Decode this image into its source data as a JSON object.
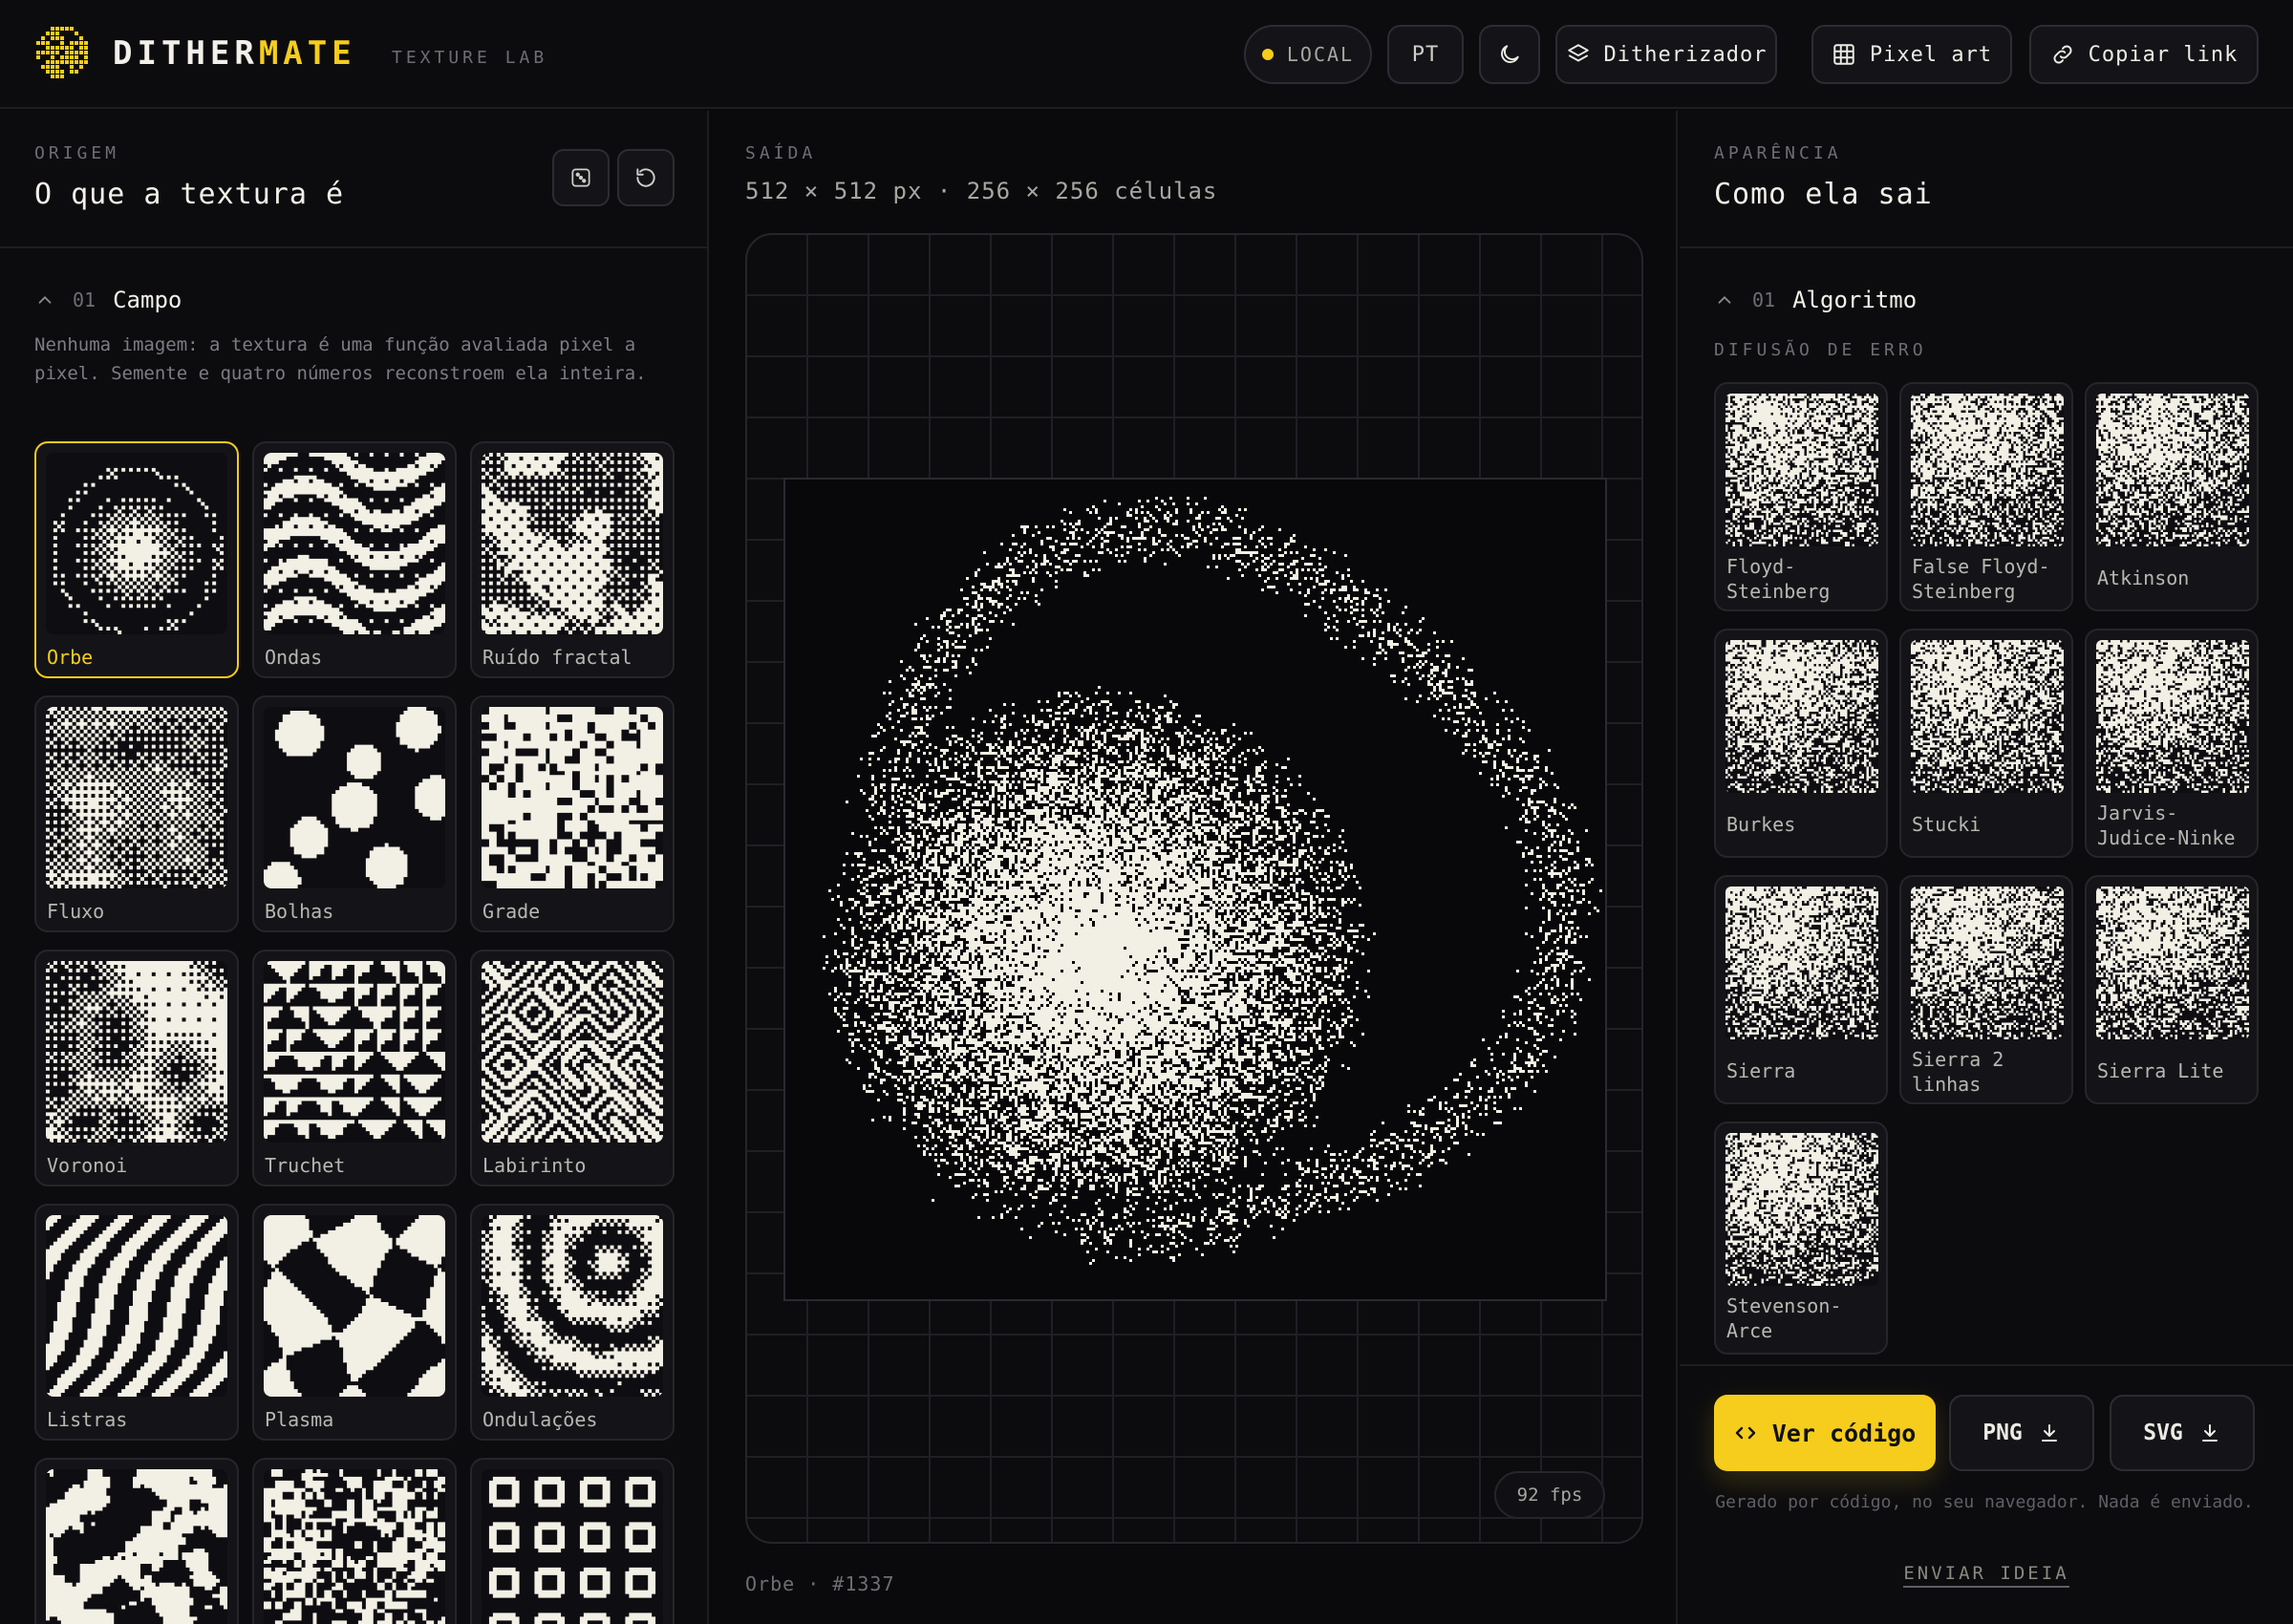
{
  "header": {
    "brand_main": "DITHER",
    "brand_accent": "MATE",
    "brand_sub": "TEXTURE LAB",
    "local_label": "LOCAL",
    "lang_label": "PT",
    "dither_label": "Ditherizador",
    "pixel_label": "Pixel art",
    "copy_label": "Copiar link"
  },
  "left": {
    "section_label": "ORIGEM",
    "title": "O que a textura é",
    "group_num": "01",
    "group_name": "Campo",
    "description": "Nenhuma imagem: a textura é uma função avaliada pixel a pixel. Semente e quatro números reconstroem ela inteira.",
    "fields": [
      {
        "name": "Orbe",
        "selected": true,
        "pattern": "orb"
      },
      {
        "name": "Ondas",
        "pattern": "waves"
      },
      {
        "name": "Ruído fractal",
        "pattern": "noise"
      },
      {
        "name": "Fluxo",
        "pattern": "flow"
      },
      {
        "name": "Bolhas",
        "pattern": "bubbles"
      },
      {
        "name": "Grade",
        "pattern": "grid"
      },
      {
        "name": "Voronoi",
        "pattern": "voronoi"
      },
      {
        "name": "Truchet",
        "pattern": "truchet"
      },
      {
        "name": "Labirinto",
        "pattern": "maze"
      },
      {
        "name": "Listras",
        "pattern": "stripes"
      },
      {
        "name": "Plasma",
        "pattern": "plasma"
      },
      {
        "name": "Ondulações",
        "pattern": "ripples"
      },
      {
        "name": "",
        "pattern": "rd"
      },
      {
        "name": "",
        "pattern": "cells"
      },
      {
        "name": "",
        "pattern": "rings"
      }
    ]
  },
  "middle": {
    "section_label": "SAÍDA",
    "dimensions": "512 × 512 px · 256 × 256 células",
    "fps": "92 fps",
    "footer": "Orbe · #1337"
  },
  "right": {
    "section_label": "APARÊNCIA",
    "title": "Como ela sai",
    "group_num": "01",
    "group_name": "Algoritmo",
    "sub_label": "DIFUSÃO DE ERRO",
    "algorithms": [
      {
        "name": "Floyd-\nSteinberg"
      },
      {
        "name": "False Floyd-\nSteinberg"
      },
      {
        "name": "Atkinson"
      },
      {
        "name": "Burkes"
      },
      {
        "name": "Stucki"
      },
      {
        "name": "Jarvis-\nJudice-Ninke"
      },
      {
        "name": "Sierra"
      },
      {
        "name": "Sierra 2\nlinhas"
      },
      {
        "name": "Sierra Lite"
      },
      {
        "name": "Stevenson-\nArce"
      }
    ],
    "code_label": "Ver código",
    "png_label": "PNG",
    "svg_label": "SVG",
    "note": "Gerado por código, no seu navegador. Nada é enviado.",
    "idea_label": "ENVIAR IDEIA"
  },
  "colors": {
    "accent": "#f6cd1c",
    "background": "#0a0a0c",
    "ink": "#f2efe4"
  },
  "icons": [
    "dither-logo",
    "moon-icon",
    "layers-icon",
    "grid-icon",
    "link-icon",
    "dice-icon",
    "reset-icon",
    "chevron-up-icon",
    "code-icon",
    "download-icon"
  ]
}
